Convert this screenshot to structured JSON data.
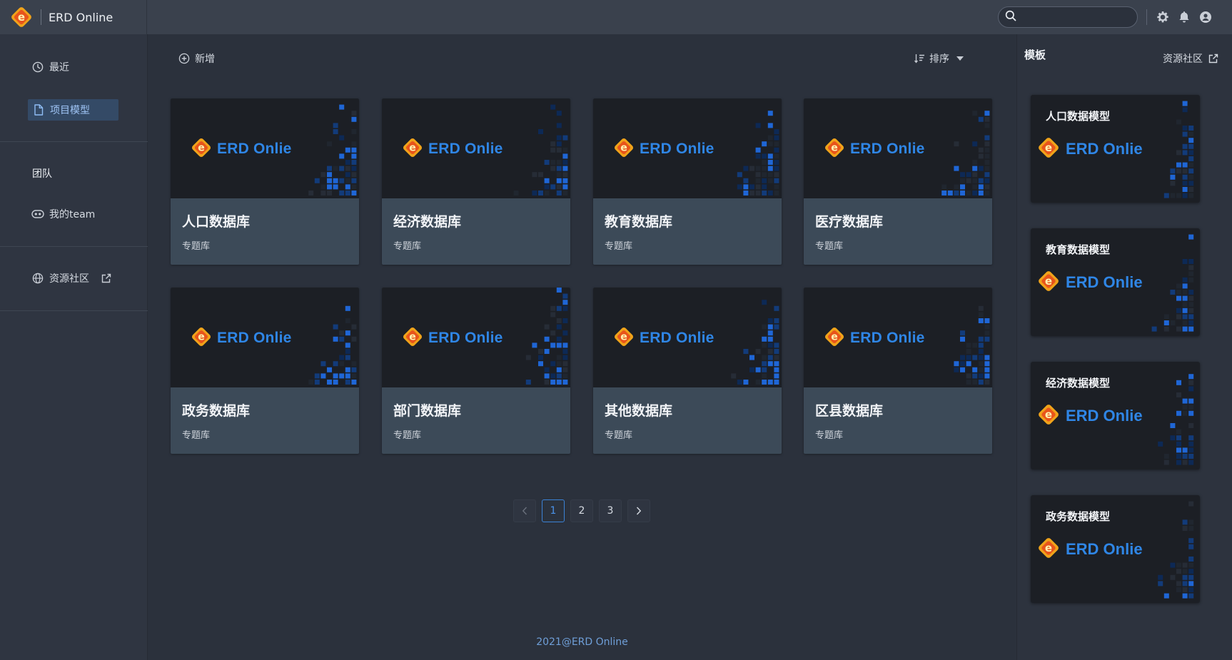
{
  "app": {
    "title": "ERD Online"
  },
  "header": {
    "search_placeholder": "",
    "icons": [
      "settings-icon",
      "bell-icon",
      "user-icon"
    ]
  },
  "sidebar": {
    "items": [
      {
        "label": "最近",
        "icon": "clock-icon"
      },
      {
        "label": "项目模型",
        "icon": "file-icon",
        "active": true
      }
    ],
    "team_title": "团队",
    "team_items": [
      {
        "label": "我的team",
        "icon": "team-icon"
      }
    ],
    "community": {
      "label": "资源社区",
      "icon": "globe-icon"
    }
  },
  "toolbar": {
    "add_label": "新增",
    "sort_label": "排序"
  },
  "brand_wordmark": "ERD Onlie",
  "cards": [
    {
      "title": "人口数据库",
      "desc": "专题库"
    },
    {
      "title": "经济数据库",
      "desc": "专题库"
    },
    {
      "title": "教育数据库",
      "desc": "专题库"
    },
    {
      "title": "医疗数据库",
      "desc": "专题库"
    },
    {
      "title": "政务数据库",
      "desc": "专题库"
    },
    {
      "title": "部门数据库",
      "desc": "专题库"
    },
    {
      "title": "其他数据库",
      "desc": "专题库"
    },
    {
      "title": "区县数据库",
      "desc": "专题库"
    }
  ],
  "pagination": {
    "pages": [
      "1",
      "2",
      "3"
    ],
    "current": "1"
  },
  "footer": "2021@ERD Online",
  "templates_panel": {
    "title": "模板",
    "link_label": "资源社区",
    "items": [
      {
        "title": "人口数据模型"
      },
      {
        "title": "教育数据模型"
      },
      {
        "title": "经济数据模型"
      },
      {
        "title": "政务数据模型"
      }
    ]
  },
  "colors": {
    "accent": "#2f86e6",
    "active_bg": "#344a66",
    "card_bg": "#3c4a58"
  }
}
